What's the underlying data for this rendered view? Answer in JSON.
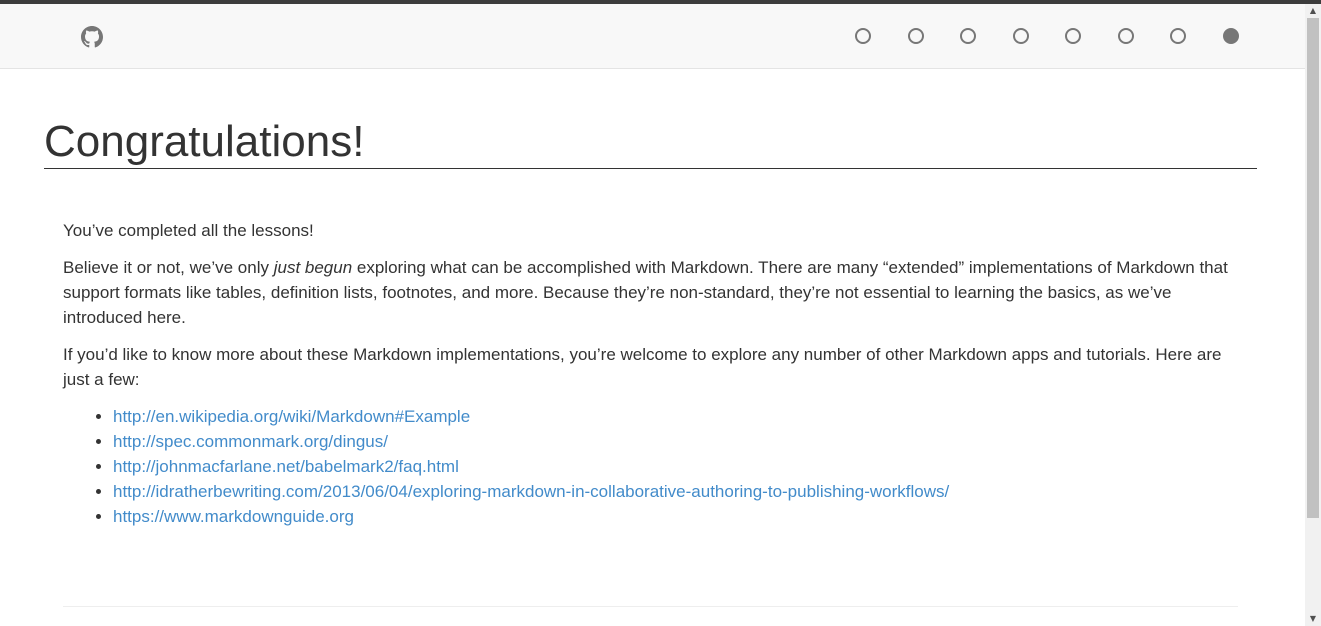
{
  "navbar": {
    "github_icon": "github-icon",
    "lesson_dots": [
      {
        "lesson": 1,
        "active": false
      },
      {
        "lesson": 2,
        "active": false
      },
      {
        "lesson": 3,
        "active": false
      },
      {
        "lesson": 4,
        "active": false
      },
      {
        "lesson": 5,
        "active": false
      },
      {
        "lesson": 6,
        "active": false
      },
      {
        "lesson": 7,
        "active": false
      },
      {
        "lesson": 8,
        "active": true
      }
    ]
  },
  "main": {
    "title": "Congratulations!",
    "intro": "You’ve completed all the lessons!",
    "para2_before": "Believe it or not, we’ve only ",
    "para2_em": "just begun",
    "para2_after": " exploring what can be accomplished with Markdown. There are many “extended” implementations of Markdown that support formats like tables, definition lists, footnotes, and more. Because they’re non-standard, they’re not essential to learning the basics, as we’ve introduced here.",
    "para3": "If you’d like to know more about these Markdown implementations, you’re welcome to explore any number of other Markdown apps and tutorials. Here are just a few:",
    "links": [
      "http://en.wikipedia.org/wiki/Markdown#Example",
      "http://spec.commonmark.org/dingus/",
      "http://johnmacfarlane.net/babelmark2/faq.html",
      "http://idratherbewriting.com/2013/06/04/exploring-markdown-in-collaborative-authoring-to-publishing-workflows/",
      "https://www.markdownguide.org"
    ]
  },
  "colors": {
    "link": "#428bca",
    "text": "#333333",
    "navbar_bg": "#f8f8f8",
    "dot": "#777777"
  }
}
